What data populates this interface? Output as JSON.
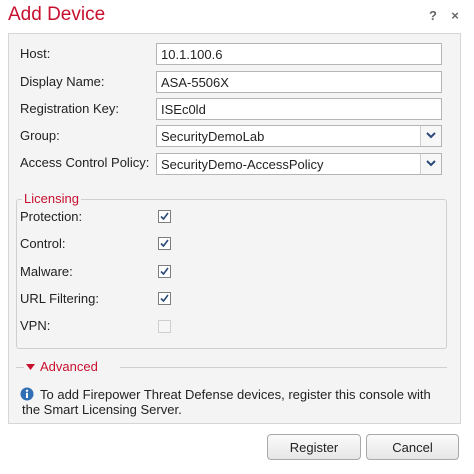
{
  "dialog": {
    "title": "Add Device",
    "help_icon": "question-mark-icon",
    "close_icon": "close-x-icon",
    "help_glyph": "?",
    "close_glyph": "×"
  },
  "form": {
    "host": {
      "label": "Host:",
      "value": "10.1.100.6"
    },
    "display_name": {
      "label": "Display Name:",
      "value": "ASA-5506X"
    },
    "registration_key": {
      "label": "Registration Key:",
      "value": "ISEc0ld"
    },
    "group": {
      "label": "Group:",
      "selected": "SecurityDemoLab"
    },
    "access_control_policy": {
      "label": "Access Control Policy:",
      "selected": "SecurityDemo-AccessPolicy"
    }
  },
  "licensing": {
    "legend": "Licensing",
    "items": [
      {
        "label": "Protection:",
        "checked": true,
        "disabled": false
      },
      {
        "label": "Control:",
        "checked": true,
        "disabled": false
      },
      {
        "label": "Malware:",
        "checked": true,
        "disabled": false
      },
      {
        "label": "URL Filtering:",
        "checked": true,
        "disabled": false
      },
      {
        "label": "VPN:",
        "checked": false,
        "disabled": true
      }
    ]
  },
  "advanced": {
    "label": "Advanced",
    "expanded": false
  },
  "info": {
    "icon": "info-icon",
    "text": "To add Firepower Threat Defense devices, register this console with the Smart Licensing Server."
  },
  "buttons": {
    "register": "Register",
    "cancel": "Cancel"
  },
  "colors": {
    "accent": "#c8102e",
    "panel_bg": "#f4f4f4",
    "info_blue": "#2f6fb5"
  }
}
